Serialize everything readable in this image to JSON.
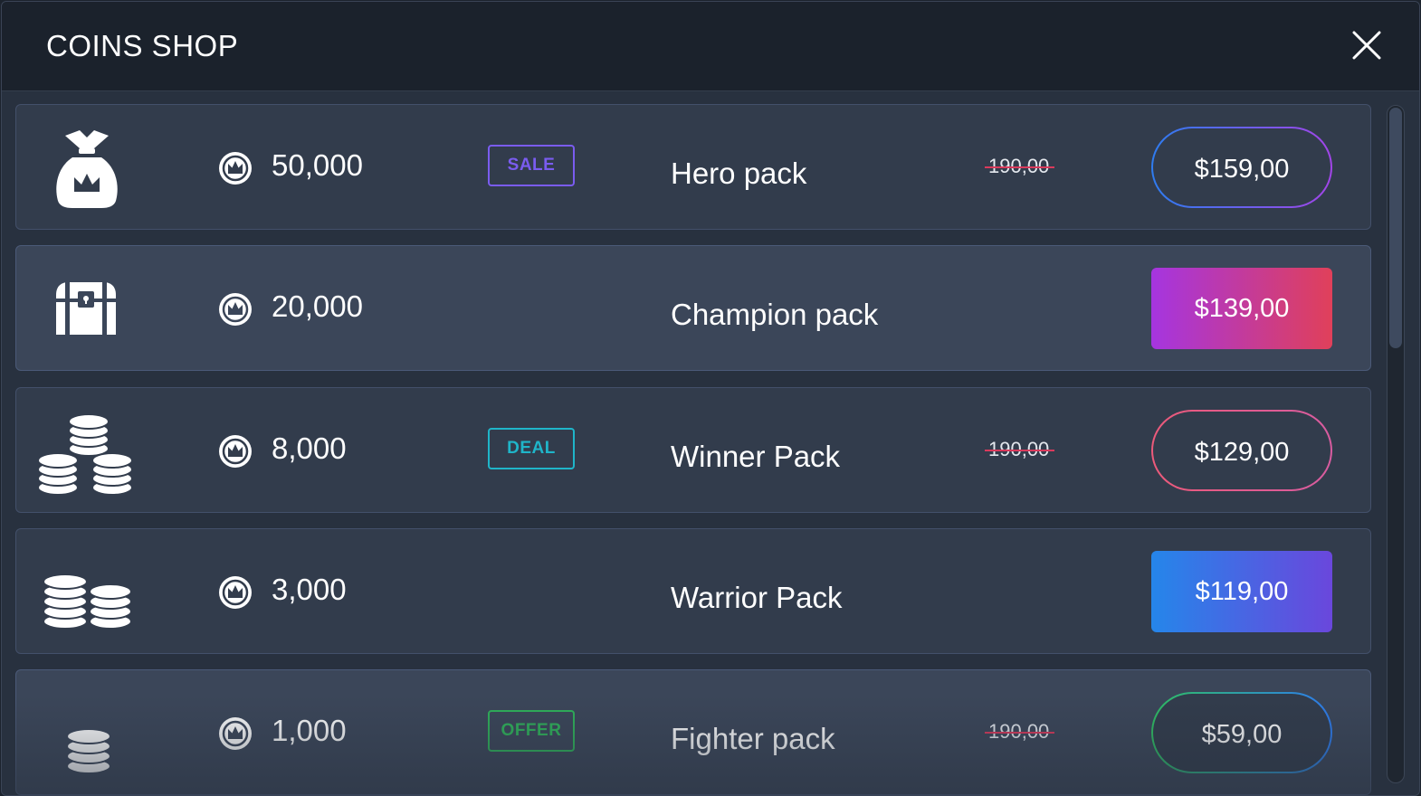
{
  "header": {
    "title": "COINS SHOP",
    "close_icon": "close-icon"
  },
  "colors": {
    "sale": "#7a5cf0",
    "deal": "#1fb5c9",
    "offer": "#2fb35a",
    "strike": "#d93a5c"
  },
  "packs": [
    {
      "icon": "money-bag-icon",
      "coins": "50,000",
      "badge": "SALE",
      "name": "Hero pack",
      "old_price": "190,00",
      "price": "$159,00"
    },
    {
      "icon": "treasure-chest-icon",
      "coins": "20,000",
      "badge": "",
      "name": "Champion pack",
      "old_price": "",
      "price": "$139,00"
    },
    {
      "icon": "coin-stacks-icon",
      "coins": "8,000",
      "badge": "DEAL",
      "name": "Winner Pack",
      "old_price": "190,00",
      "price": "$129,00"
    },
    {
      "icon": "coin-piles-icon",
      "coins": "3,000",
      "badge": "",
      "name": "Warrior Pack",
      "old_price": "",
      "price": "$119,00"
    },
    {
      "icon": "coin-stack-icon",
      "coins": "1,000",
      "badge": "OFFER",
      "name": "Fighter pack",
      "old_price": "190,00",
      "price": "$59,00"
    }
  ]
}
